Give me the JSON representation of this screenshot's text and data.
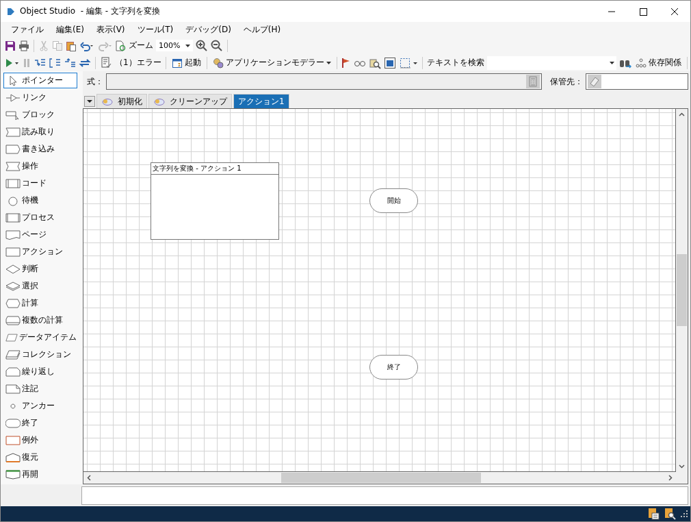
{
  "window": {
    "title": "Object Studio  - 編集 - 文字列を変換"
  },
  "menu": [
    {
      "label": "ファイル"
    },
    {
      "label": "編集(E)"
    },
    {
      "label": "表示(V)"
    },
    {
      "label": "ツール(T)"
    },
    {
      "label": "デバッグ(D)"
    },
    {
      "label": "ヘルプ(H)"
    }
  ],
  "toolbar": {
    "zoom_label": "ズーム",
    "zoom_value": "100%",
    "errors": "（1）エラー",
    "launch": "起動",
    "app_modeller": "アプリケーションモデラー",
    "search_label": "テキストを検索",
    "dependencies": "依存関係"
  },
  "expression": {
    "label": "式：",
    "store_label": "保管先："
  },
  "palette": [
    {
      "label": "ポインター",
      "selected": true
    },
    {
      "label": "リンク",
      "selected": false
    },
    {
      "label": "ブロック",
      "selected": false
    },
    {
      "label": "読み取り",
      "selected": false
    },
    {
      "label": "書き込み",
      "selected": false
    },
    {
      "label": "操作",
      "selected": false
    },
    {
      "label": "コード",
      "selected": false
    },
    {
      "label": "待機",
      "selected": false
    },
    {
      "label": "プロセス",
      "selected": false
    },
    {
      "label": "ページ",
      "selected": false
    },
    {
      "label": "アクション",
      "selected": false
    },
    {
      "label": "判断",
      "selected": false
    },
    {
      "label": "選択",
      "selected": false
    },
    {
      "label": "計算",
      "selected": false
    },
    {
      "label": "複数の計算",
      "selected": false
    },
    {
      "label": "データアイテム",
      "selected": false
    },
    {
      "label": "コレクション",
      "selected": false
    },
    {
      "label": "繰り返し",
      "selected": false
    },
    {
      "label": "注記",
      "selected": false
    },
    {
      "label": "アンカー",
      "selected": false
    },
    {
      "label": "終了",
      "selected": false
    },
    {
      "label": "例外",
      "selected": false
    },
    {
      "label": "復元",
      "selected": false
    },
    {
      "label": "再開",
      "selected": false
    }
  ],
  "tabs": [
    {
      "label": "初期化",
      "selected": false
    },
    {
      "label": "クリーンアップ",
      "selected": false
    },
    {
      "label": "アクション1",
      "selected": true
    }
  ],
  "canvas": {
    "block": {
      "title": "文字列を変換 - アクション 1"
    },
    "nodes": [
      {
        "kind": "start",
        "label": "開始"
      },
      {
        "kind": "end",
        "label": "終了"
      }
    ]
  }
}
